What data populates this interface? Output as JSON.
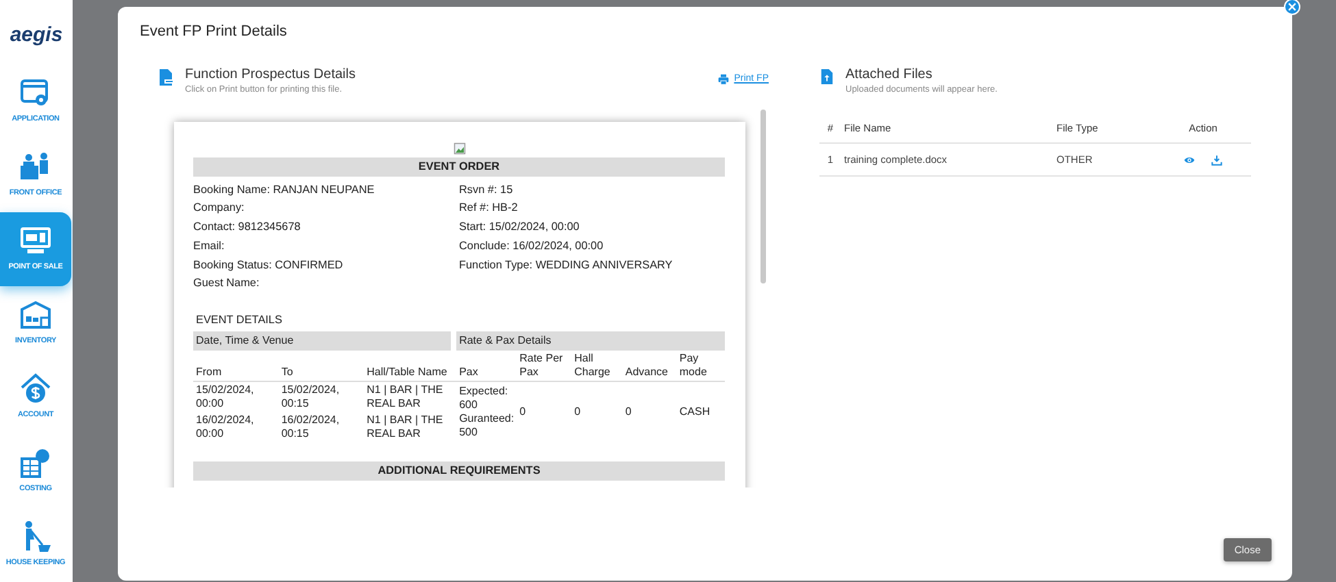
{
  "sidebar": {
    "logo": "aegis",
    "items": [
      {
        "label": "APPLICATION",
        "kind": "app",
        "selected": false
      },
      {
        "label": "FRONT OFFICE",
        "kind": "front",
        "selected": false
      },
      {
        "label": "POINT OF SALE",
        "kind": "pos",
        "selected": true
      },
      {
        "label": "INVENTORY",
        "kind": "inventory",
        "selected": false
      },
      {
        "label": "ACCOUNT",
        "kind": "account",
        "selected": false
      },
      {
        "label": "COSTING",
        "kind": "costing",
        "selected": false
      },
      {
        "label": "HOUSE KEEPING",
        "kind": "housekeeping",
        "selected": false
      }
    ]
  },
  "modal": {
    "title": "Event FP Print Details",
    "prospectus": {
      "title": "Function Prospectus Details",
      "subtitle": "Click on Print button for printing this file.",
      "print_link": "Print FP",
      "document": {
        "heading": "EVENT ORDER",
        "left_fields": [
          "Booking Name: RANJAN NEUPANE",
          "Company:",
          "Contact: 9812345678",
          "Email:",
          "Booking Status: CONFIRMED",
          "Guest Name:"
        ],
        "right_fields": [
          "Rsvn #: 15",
          "Ref #: HB-2",
          "Start: 15/02/2024, 00:00",
          "Conclude: 16/02/2024, 00:00",
          "Function Type: WEDDING ANNIVERSARY"
        ],
        "event_details_title": "EVENT DETAILS",
        "venue_header": "Date, Time & Venue",
        "rate_header": "Rate & Pax Details",
        "venue_columns": [
          "From",
          "To",
          "Hall/Table Name"
        ],
        "rate_columns": [
          "Pax",
          "Rate Per Pax",
          "Hall Charge",
          "Advance",
          "Pay mode"
        ],
        "venue_rows": [
          [
            "15/02/2024, 00:00",
            "15/02/2024, 00:15",
            "N1 | BAR | THE REAL BAR"
          ],
          [
            "16/02/2024, 00:00",
            "16/02/2024, 00:15",
            "N1 | BAR | THE REAL BAR"
          ]
        ],
        "rate_row": {
          "pax": [
            "Expected: 600",
            "Guranteed: 500"
          ],
          "rate_per_pax": "0",
          "hall_charge": "0",
          "advance": "0",
          "pay_mode": "CASH"
        },
        "additional_heading": "ADDITIONAL REQUIREMENTS"
      }
    },
    "attached_files": {
      "title": "Attached Files",
      "subtitle": "Uploaded documents will appear here.",
      "columns": [
        "#",
        "File Name",
        "File Type",
        "Action"
      ],
      "rows": [
        {
          "number": "1",
          "file_name": "training complete.docx",
          "file_type": "OTHER"
        }
      ]
    },
    "close_button": "Close"
  }
}
